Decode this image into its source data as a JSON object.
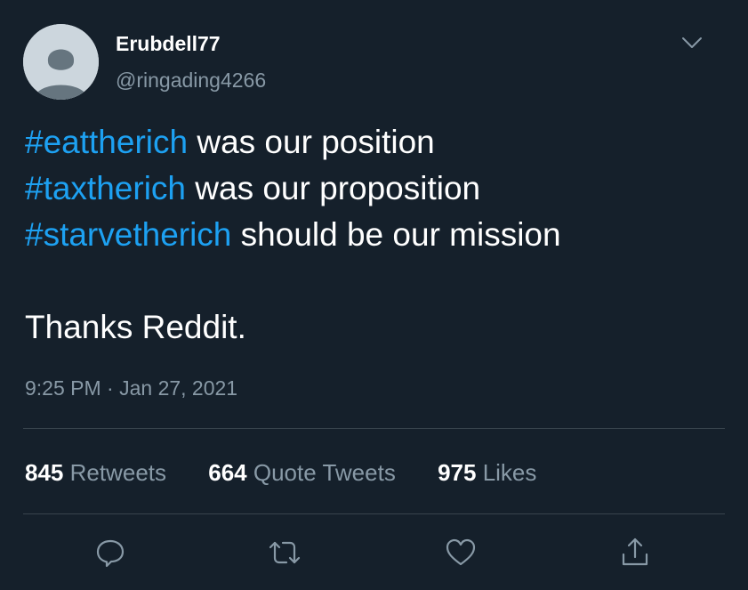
{
  "user": {
    "display_name": "Erubdell77",
    "handle": "@ringading4266"
  },
  "tweet": {
    "lines": [
      {
        "hashtag": "#eattherich",
        "text": " was our position"
      },
      {
        "hashtag": "#taxtherich",
        "text": " was our proposition"
      },
      {
        "hashtag": "#starvetherich",
        "text": " should be our mission"
      }
    ],
    "closing": "Thanks Reddit.",
    "timestamp": "9:25 PM · Jan 27, 2021"
  },
  "stats": [
    {
      "count": "845",
      "label": "Retweets"
    },
    {
      "count": "664",
      "label": "Quote Tweets"
    },
    {
      "count": "975",
      "label": "Likes"
    }
  ],
  "actions": [
    "reply-icon",
    "retweet-icon",
    "like-icon",
    "share-icon"
  ],
  "colors": {
    "background": "#15202b",
    "hashtag": "#1da1f2",
    "secondary_text": "#8899a6",
    "divider": "#38444d"
  }
}
